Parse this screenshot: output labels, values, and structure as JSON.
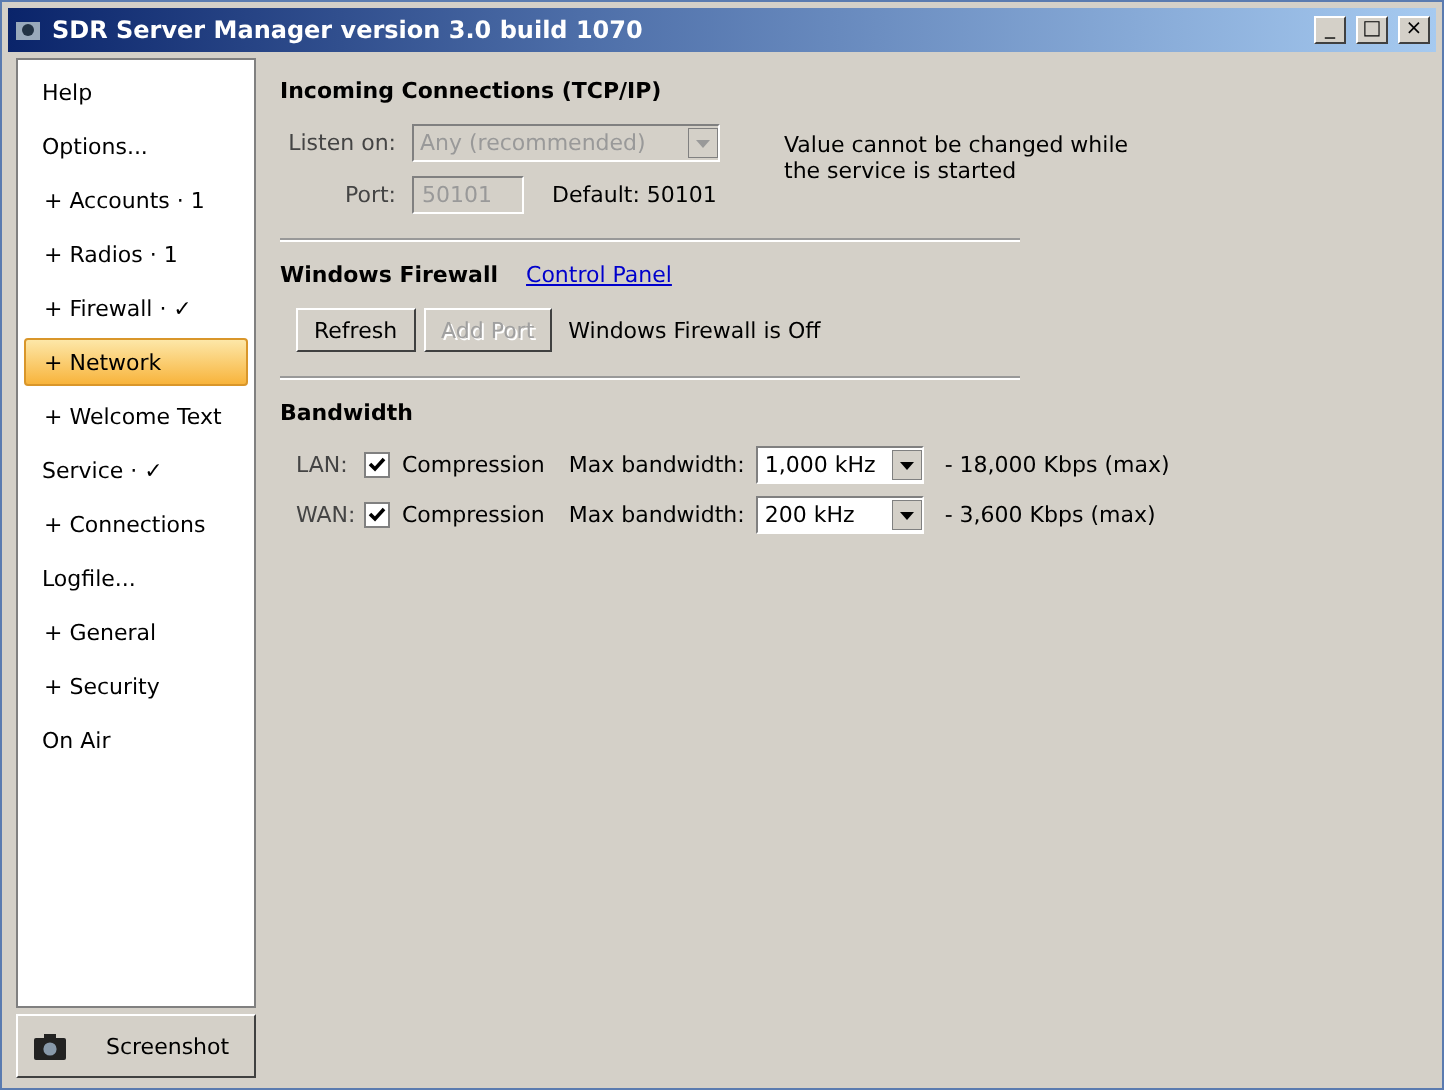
{
  "window": {
    "title": "SDR Server Manager version 3.0 build 1070",
    "controls": [
      "_",
      "□",
      "×"
    ]
  },
  "sidebar": {
    "items": [
      {
        "label": "Help",
        "kind": "top",
        "selected": false
      },
      {
        "label": "Options...",
        "kind": "top",
        "selected": false
      },
      {
        "label": "+ Accounts · 1",
        "kind": "sub",
        "selected": false
      },
      {
        "label": "+ Radios · 1",
        "kind": "sub",
        "selected": false
      },
      {
        "label": "+ Firewall · ✓",
        "kind": "sub",
        "selected": false
      },
      {
        "label": "+ Network",
        "kind": "sub",
        "selected": true
      },
      {
        "label": "+ Welcome Text",
        "kind": "sub",
        "selected": false
      },
      {
        "label": "Service · ✓",
        "kind": "top",
        "selected": false
      },
      {
        "label": "+ Connections",
        "kind": "sub",
        "selected": false
      },
      {
        "label": "Logfile...",
        "kind": "top",
        "selected": false
      },
      {
        "label": "+ General",
        "kind": "sub",
        "selected": false
      },
      {
        "label": "+ Security",
        "kind": "sub",
        "selected": false
      },
      {
        "label": "On Air",
        "kind": "top",
        "selected": false
      }
    ],
    "screenshot_button": "Screenshot"
  },
  "incoming": {
    "title": "Incoming Connections (TCP/IP)",
    "listen_label": "Listen on:",
    "listen_value": "Any (recommended)",
    "port_label": "Port:",
    "port_value": "50101",
    "default": "Default: 50101",
    "note": "Value cannot be changed while the service is started",
    "disabled": true
  },
  "firewall": {
    "title": "Windows Firewall",
    "link": "Control Panel",
    "buttons": [
      {
        "label": "Refresh",
        "disabled": false
      },
      {
        "label": "Add Port",
        "disabled": true
      }
    ],
    "status": "Windows Firewall is Off"
  },
  "bandwidth": {
    "title": "Bandwidth",
    "rows": [
      {
        "label": "LAN:",
        "compression": "Compression",
        "checked": true,
        "max_label": "Max bandwidth:",
        "value": "1,000 kHz",
        "rate": "- 18,000 Kbps (max)"
      },
      {
        "label": "WAN:",
        "compression": "Compression",
        "checked": true,
        "max_label": "Max bandwidth:",
        "value": "200 kHz",
        "rate": "- 3,600 Kbps (max)"
      }
    ]
  }
}
